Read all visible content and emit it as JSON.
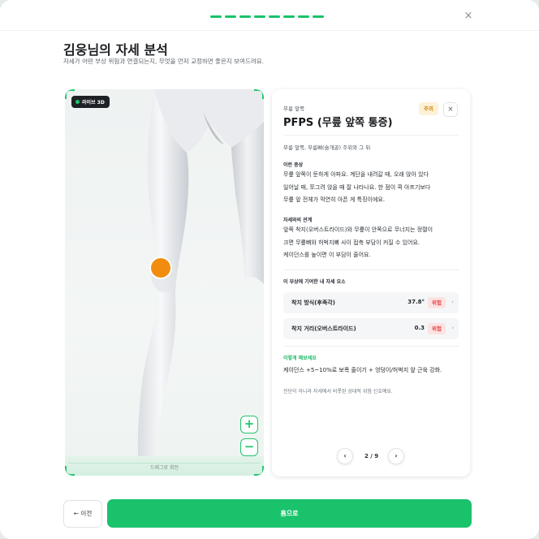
{
  "header": {
    "close_icon": "×",
    "progress_steps": 9,
    "accent_color": "#19c26b"
  },
  "page": {
    "title": "김웅님의 자세 분석",
    "subtitle": "자세가 어떤 부상 위험과 연결되는지, 무엇을 먼저 교정하면 좋은지 보여드려요."
  },
  "viewer": {
    "badge": "라이브 3D",
    "hint": "드래그로 회전",
    "zoom_in": "+",
    "zoom_out": "−",
    "marker_color": "#f28c0f"
  },
  "panel": {
    "category": "무릎 앞쪽",
    "title": "PFPS (무릎 앞쪽 통증)",
    "status_badge": "주의",
    "close_icon": "×",
    "location": "무릎 앞쪽, 무릎뼈(슬개골) 주위와 그 뒤",
    "symptoms_title": "이런 증상",
    "symptoms_lines": [
      "무릎 앞쪽이 둔하게 아파요. 계단을 내려갈 때, 오래 앉아 있다",
      "일어날 때, 쪼그려 앉을 때 잘 나타나요. 한 점이 콕 아프기보다",
      "무릎 앞 전체가 막연히 아픈 게 특징이에요."
    ],
    "relation_title": "자세와의 관계",
    "relation_lines": [
      "앞쪽 착지(오버스트라이드)와 무릎이 안쪽으로 무너지는 정렬이",
      "크면 무릎뼈와 허벅지뼈 사이 접촉 부담이 커질 수 있어요.",
      "케이던스를 높이면 이 부담이 줄어요."
    ],
    "metrics_title": "이 부상에 기여한 내 자세 요소",
    "metrics": [
      {
        "label": "착지 방식(후족각)",
        "value": "37.8°",
        "badge": "위험",
        "chevron": "›"
      },
      {
        "label": "착지 거리(오버스트라이드)",
        "value": "0.3",
        "badge": "위험",
        "chevron": "›"
      }
    ],
    "tip_title": "이렇게 해보세요",
    "tip_text": "케이던스 +5~10%로 보폭 줄이기 + 엉덩이/허벅지 앞 근육 강화.",
    "note": "진단이 아니라 자세에서 비롯된 상대적 위험 신호예요.",
    "pager": {
      "prev": "‹",
      "next": "›",
      "text": "2 / 9"
    }
  },
  "footer": {
    "prev_label": "← 이전",
    "home_label": "홈으로"
  }
}
